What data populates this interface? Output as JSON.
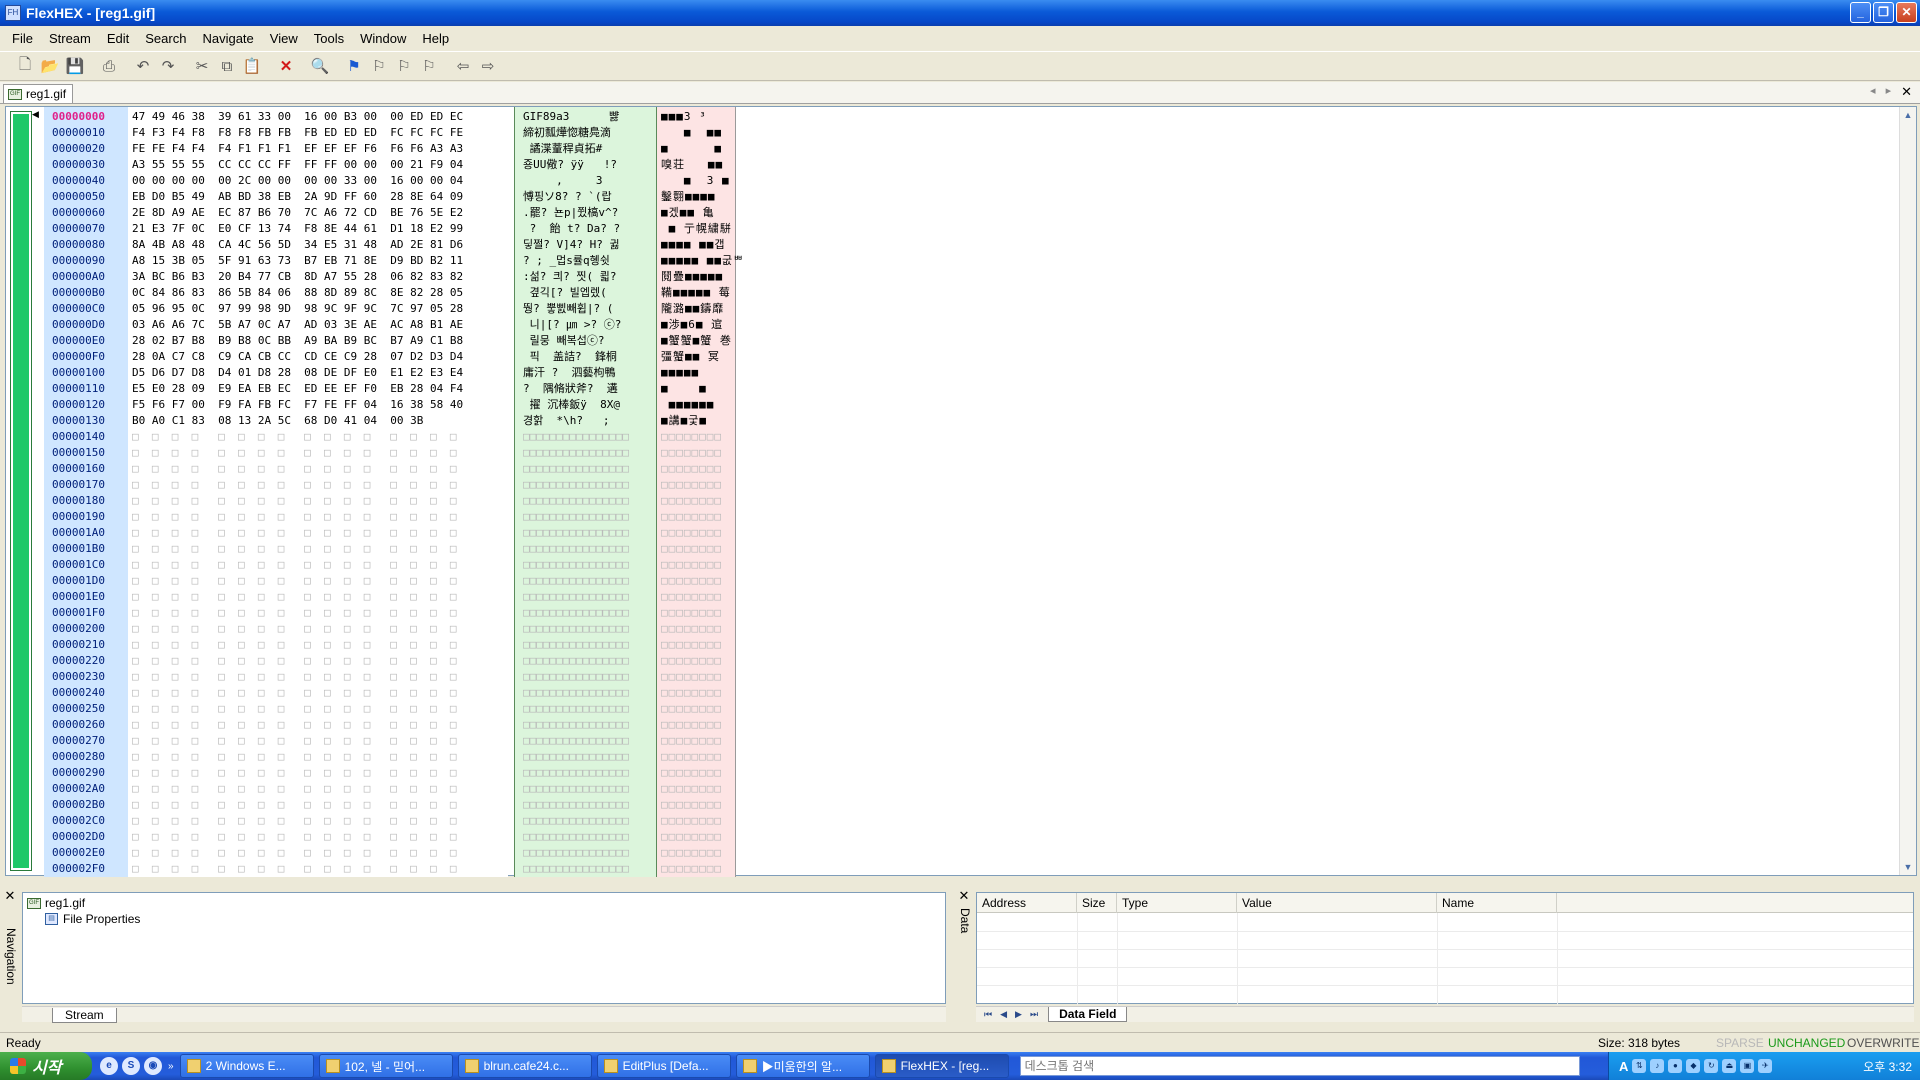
{
  "window": {
    "title": "FlexHEX - [reg1.gif]",
    "minimize": "_",
    "restore": "❐",
    "close": "✕"
  },
  "menu": [
    "File",
    "Stream",
    "Edit",
    "Search",
    "Navigate",
    "View",
    "Tools",
    "Window",
    "Help"
  ],
  "tab": {
    "label": "reg1.gif",
    "prev": "◂",
    "next": "▸",
    "close": "✕"
  },
  "rows": [
    {
      "addr": "00000000",
      "hex": "47 49 46 38  39 61 33 00  16 00 B3 00  00 ED ED EC",
      "ascii": "GIF89a3      뺧",
      "aux": "■■■3 ³   "
    },
    {
      "addr": "00000010",
      "hex": "F4 F3 F4 F8  F8 F8 FB FB  FB ED ED ED  FC FC FC FE",
      "ascii": "締初瓢燁惚糖鳧滴",
      "aux": "   ■  ■■"
    },
    {
      "addr": "00000020",
      "hex": "FE FE F4 F4  F4 F1 F1 F1  EF EF EF F6  F6 F6 A3 A3",
      "ascii": " 譎渫蕫稈貞拓#",
      "aux": "■      ■"
    },
    {
      "addr": "00000030",
      "hex": "A3 55 55 55  CC CC CC FF  FF FF 00 00  00 21 F9 04",
      "ascii": "죵UU儆? ÿÿ   !?",
      "aux": "嗅荘   ■■"
    },
    {
      "addr": "00000040",
      "hex": "00 00 00 00  00 2C 00 00  00 00 33 00  16 00 00 04",
      "ascii": "     ,     3",
      "aux": "   ■  3 ■"
    },
    {
      "addr": "00000050",
      "hex": "EB D0 B5 49  AB BD 38 EB  2A 9D FF 60  28 8E 64 09",
      "ascii": "愽핑ソ8? ? `(랍",
      "aux": "鑿翾■■■■"
    },
    {
      "addr": "00000060",
      "hex": "2E 8D A9 AE  EC 87 B6 70  7C A6 72 CD  BE 76 5E E2",
      "ascii": ".罷? 뇬p|쮰槁v^?",
      "aux": "■겠■■ 亀 "
    },
    {
      "addr": "00000070",
      "hex": "21 E3 7F 0C  E0 CF 13 74  F8 8E 44 61  D1 18 E2 99",
      "ascii": " ?  飴 t? Da? ?",
      "aux": " ■ 亍幌繍駢"
    },
    {
      "addr": "00000080",
      "hex": "8A 4B A8 48  CA 4C 56 5D  34 E5 31 48  AD 2E 81 D6",
      "ascii": "딯쩔? V]4? H? 귏",
      "aux": "■■■■ ■■갭"
    },
    {
      "addr": "00000090",
      "hex": "A8 15 3B 05  5F 91 63 73  B7 EB 71 8E  D9 BD B2 11",
      "ascii": "? ; _멉s률q혱쉿",
      "aux": "■■■■■ ■■굾ᄈ"
    },
    {
      "addr": "000000A0",
      "hex": "3A BC B6 B3  20 B4 77 CB  8D A7 55 28  06 82 83 82",
      "ascii": ":섦? 킈? 찟( 쾳?",
      "aux": "鬩疊■■■■■"
    },
    {
      "addr": "000000B0",
      "hex": "0C 84 86 83  86 5B 84 06  88 8D 89 8C  8E 82 28 05",
      "ascii": " 곂긱[? 빌엡렜(",
      "aux": "鞴■■■■■ 莓"
    },
    {
      "addr": "000000C0",
      "hex": "05 96 95 0C  97 99 98 9D  98 9C 9F 9C  7C 97 05 28",
      "ascii": "뛍? 뿧삜빼휩|? (",
      "aux": "隴潞■■鑄靡"
    },
    {
      "addr": "000000D0",
      "hex": "03 A6 A6 7C  5B A7 0C A7  AD 03 3E AE  AC A8 B1 AE",
      "ascii": " 니|[? ㎛ >? ⓒ?",
      "aux": "■渉■6■ 逭"
    },
    {
      "addr": "000000E0",
      "hex": "28 02 B7 B8  B9 B8 0C BB  A9 BA B9 BC  B7 A9 C1 B8",
      "ascii": " 릴뭉 빼복섭ⓒ?",
      "aux": "■蟹蟹■蟹 巻"
    },
    {
      "addr": "000000F0",
      "hex": "28 0A C7 C8  C9 CA CB CC  CD CE C9 28  07 D2 D3 D4",
      "ascii": " 픽  盖詰?  鋒桐",
      "aux": "彊蟹■■ 冥"
    },
    {
      "addr": "00000100",
      "hex": "D5 D6 D7 D8  D4 01 D8 28  08 DE DF E0  E1 E2 E3 E4",
      "ascii": "庸汗 ?  泗藝枸鴨",
      "aux": "■■■■■"
    },
    {
      "addr": "00000110",
      "hex": "E5 E0 28 09  E9 EA EB EC  ED EE EF F0  EB 28 04 F4",
      "ascii": "?  隅脩狀斧?  遘",
      "aux": "■    ■ "
    },
    {
      "addr": "00000120",
      "hex": "F5 F6 F7 00  F9 FA FB FC  F7 FE FF 04  16 38 58 40",
      "ascii": " 擢 沉棒鈑ÿ  8X@",
      "aux": " ■■■■■■"
    },
    {
      "addr": "00000130",
      "hex": "B0 A0 C1 83  08 13 2A 5C  68 D0 41 04  00 3B",
      "ascii": "경핡  *\\h?   ;",
      "aux": "■講■궃■"
    },
    {
      "addr": "00000140"
    },
    {
      "addr": "00000150"
    },
    {
      "addr": "00000160"
    },
    {
      "addr": "00000170"
    },
    {
      "addr": "00000180"
    },
    {
      "addr": "00000190"
    },
    {
      "addr": "000001A0"
    },
    {
      "addr": "000001B0"
    },
    {
      "addr": "000001C0"
    },
    {
      "addr": "000001D0"
    },
    {
      "addr": "000001E0"
    },
    {
      "addr": "000001F0"
    },
    {
      "addr": "00000200"
    },
    {
      "addr": "00000210"
    },
    {
      "addr": "00000220"
    },
    {
      "addr": "00000230"
    },
    {
      "addr": "00000240"
    },
    {
      "addr": "00000250"
    },
    {
      "addr": "00000260"
    },
    {
      "addr": "00000270"
    },
    {
      "addr": "00000280"
    },
    {
      "addr": "00000290"
    },
    {
      "addr": "000002A0"
    },
    {
      "addr": "000002B0"
    },
    {
      "addr": "000002C0"
    },
    {
      "addr": "000002D0"
    },
    {
      "addr": "000002E0"
    },
    {
      "addr": "000002F0"
    }
  ],
  "navigation": {
    "label": "Navigation",
    "root": "reg1.gif",
    "child": "File Properties",
    "stream_tab": "Stream"
  },
  "data_panel": {
    "label": "Data",
    "columns": [
      "Address",
      "Size",
      "Type",
      "Value",
      "Name"
    ],
    "tab": "Data Field"
  },
  "status": {
    "ready": "Ready",
    "size": "Size: 318 bytes",
    "sparse": "SPARSE",
    "unchanged": "UNCHANGED",
    "mode": "OVERWRITE"
  },
  "taskbar": {
    "start": "시작",
    "buttons": [
      "2 Windows E...",
      "102, 넬 - 믿어...",
      "blrun.cafe24.c...",
      "EditPlus [Defa...",
      "▶미움한의 알...",
      "FlexHEX - [reg..."
    ],
    "search_placeholder": "데스크톱 검색",
    "ime": "A",
    "clock": "오후 3:32"
  }
}
